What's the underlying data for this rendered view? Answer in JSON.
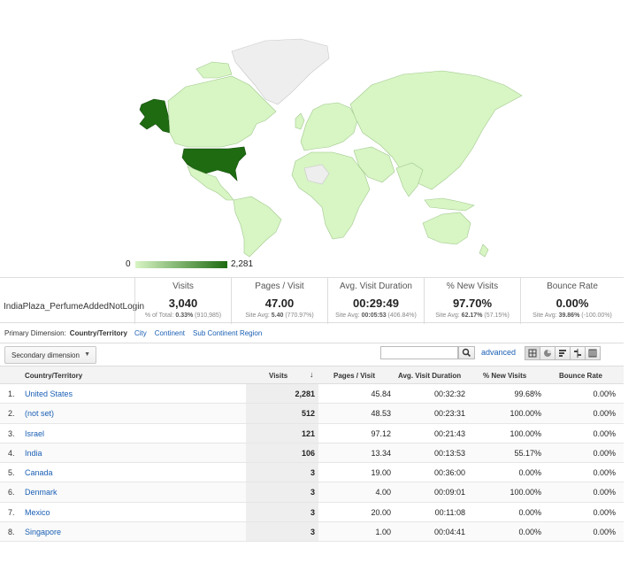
{
  "legend": {
    "min": "0",
    "max": "2,281"
  },
  "colors": {
    "map_base": "#d8f5c4",
    "map_high": "#1e6b11",
    "map_nodata": "#eeeeee",
    "link": "#1a5fb4"
  },
  "segment": "IndiaPlaza_PerfumeAddedNotLogin",
  "metrics": [
    {
      "label": "Visits",
      "value": "3,040",
      "sub_pre": "% of Total: ",
      "sub_b": "0.33%",
      "sub_post": " (910,985)"
    },
    {
      "label": "Pages / Visit",
      "value": "47.00",
      "sub_pre": "Site Avg: ",
      "sub_b": "5.40",
      "sub_post": " (770.97%)"
    },
    {
      "label": "Avg. Visit Duration",
      "value": "00:29:49",
      "sub_pre": "Site Avg: ",
      "sub_b": "00:05:53",
      "sub_post": " (406.84%)"
    },
    {
      "label": "% New Visits",
      "value": "97.70%",
      "sub_pre": "Site Avg: ",
      "sub_b": "62.17%",
      "sub_post": " (57.15%)"
    },
    {
      "label": "Bounce Rate",
      "value": "0.00%",
      "sub_pre": "Site Avg: ",
      "sub_b": "39.86%",
      "sub_post": " (-100.00%)"
    }
  ],
  "primary": {
    "label": "Primary Dimension:",
    "current": "Country/Territory",
    "options": [
      "City",
      "Continent",
      "Sub Continent Region"
    ]
  },
  "toolbar": {
    "secondary": "Secondary dimension",
    "search_value": "",
    "advanced": "advanced",
    "view_icons": [
      "table-view-icon",
      "pie-view-icon",
      "performance-view-icon",
      "comparison-view-icon",
      "pivot-view-icon"
    ]
  },
  "table": {
    "headers": {
      "country": "Country/Territory",
      "visits": "Visits",
      "pages": "Pages / Visit",
      "duration": "Avg. Visit Duration",
      "new": "% New Visits",
      "bounce": "Bounce Rate"
    },
    "rows": [
      {
        "idx": "1.",
        "country": "United States",
        "visits": "2,281",
        "pages": "45.84",
        "duration": "00:32:32",
        "new": "99.68%",
        "bounce": "0.00%"
      },
      {
        "idx": "2.",
        "country": "(not set)",
        "visits": "512",
        "pages": "48.53",
        "duration": "00:23:31",
        "new": "100.00%",
        "bounce": "0.00%"
      },
      {
        "idx": "3.",
        "country": "Israel",
        "visits": "121",
        "pages": "97.12",
        "duration": "00:21:43",
        "new": "100.00%",
        "bounce": "0.00%"
      },
      {
        "idx": "4.",
        "country": "India",
        "visits": "106",
        "pages": "13.34",
        "duration": "00:13:53",
        "new": "55.17%",
        "bounce": "0.00%"
      },
      {
        "idx": "5.",
        "country": "Canada",
        "visits": "3",
        "pages": "19.00",
        "duration": "00:36:00",
        "new": "0.00%",
        "bounce": "0.00%"
      },
      {
        "idx": "6.",
        "country": "Denmark",
        "visits": "3",
        "pages": "4.00",
        "duration": "00:09:01",
        "new": "100.00%",
        "bounce": "0.00%"
      },
      {
        "idx": "7.",
        "country": "Mexico",
        "visits": "3",
        "pages": "20.00",
        "duration": "00:11:08",
        "new": "0.00%",
        "bounce": "0.00%"
      },
      {
        "idx": "8.",
        "country": "Singapore",
        "visits": "3",
        "pages": "1.00",
        "duration": "00:04:41",
        "new": "0.00%",
        "bounce": "0.00%"
      }
    ]
  }
}
